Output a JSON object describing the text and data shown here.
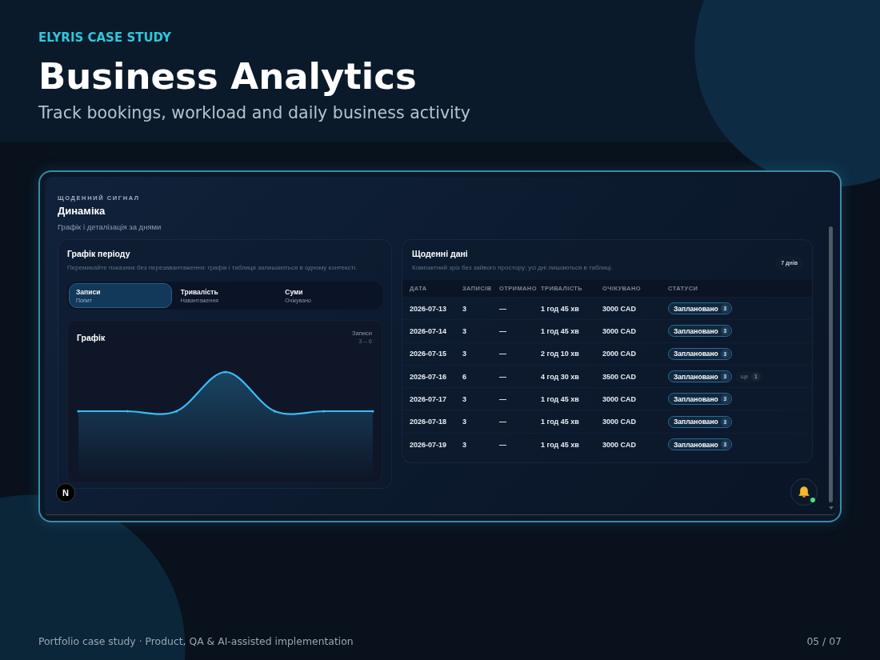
{
  "eyebrow": "ELYRIS CASE STUDY",
  "title": "Business Analytics",
  "subtitle": "Track bookings, workload and daily business activity",
  "app": {
    "section_label": "ЩОДЕННИЙ СИГНАЛ",
    "heading": "Динаміка",
    "description": "Графік і деталізація за днями",
    "period_panel": {
      "title": "Графік періоду",
      "hint": "Перемикайте показник без перезавантаження: графік і таблиця залишаються в одному контексті.",
      "tabs": [
        {
          "label": "Записи",
          "caption": "Попит",
          "selected": true
        },
        {
          "label": "Тривалість",
          "caption": "Навантаження",
          "selected": false
        },
        {
          "label": "Суми",
          "caption": "Очікувано",
          "selected": false
        }
      ],
      "chart": {
        "title": "Графік",
        "metric": "Записи",
        "range": "3 – 6"
      }
    },
    "daily_panel": {
      "title": "Щоденні дані",
      "hint": "Компактний зріз без зайвого простору; усі дні лишаються в таблиці.",
      "badge": "7 днів",
      "columns": [
        "ДАТА",
        "ЗАПИСІВ",
        "ОТРИМАНО",
        "ТРИВАЛІСТЬ",
        "ОЧІКУВАНО",
        "СТАТУСИ"
      ],
      "rows": [
        {
          "date": "2026-07-13",
          "records": "3",
          "received": "—",
          "duration": "1 год 45 хв",
          "expected": "3000 CAD",
          "statuses": [
            {
              "label": "Заплановано",
              "count": "3"
            }
          ]
        },
        {
          "date": "2026-07-14",
          "records": "3",
          "received": "—",
          "duration": "1 год 45 хв",
          "expected": "3000 CAD",
          "statuses": [
            {
              "label": "Заплановано",
              "count": "3"
            }
          ]
        },
        {
          "date": "2026-07-15",
          "records": "3",
          "received": "—",
          "duration": "2 год 10 хв",
          "expected": "2000 CAD",
          "statuses": [
            {
              "label": "Заплановано",
              "count": "3"
            }
          ]
        },
        {
          "date": "2026-07-16",
          "records": "6",
          "received": "—",
          "duration": "4 год 30 хв",
          "expected": "3500 CAD",
          "statuses": [
            {
              "label": "Заплановано",
              "count": "3"
            }
          ],
          "more": {
            "label": "ще",
            "count": "1"
          }
        },
        {
          "date": "2026-07-17",
          "records": "3",
          "received": "—",
          "duration": "1 год 45 хв",
          "expected": "3000 CAD",
          "statuses": [
            {
              "label": "Заплановано",
              "count": "3"
            }
          ]
        },
        {
          "date": "2026-07-18",
          "records": "3",
          "received": "—",
          "duration": "1 год 45 хв",
          "expected": "3000 CAD",
          "statuses": [
            {
              "label": "Заплановано",
              "count": "3"
            }
          ]
        },
        {
          "date": "2026-07-19",
          "records": "3",
          "received": "—",
          "duration": "1 год 45 хв",
          "expected": "3000 CAD",
          "statuses": [
            {
              "label": "Заплановано",
              "count": "3"
            }
          ]
        }
      ]
    },
    "dev_badge": {
      "label": "N"
    },
    "notification_button": {
      "unread_dot": true
    }
  },
  "footer": {
    "text": "Portfolio case study · Product, QA & AI-assisted implementation",
    "page": "05 / 07"
  }
}
